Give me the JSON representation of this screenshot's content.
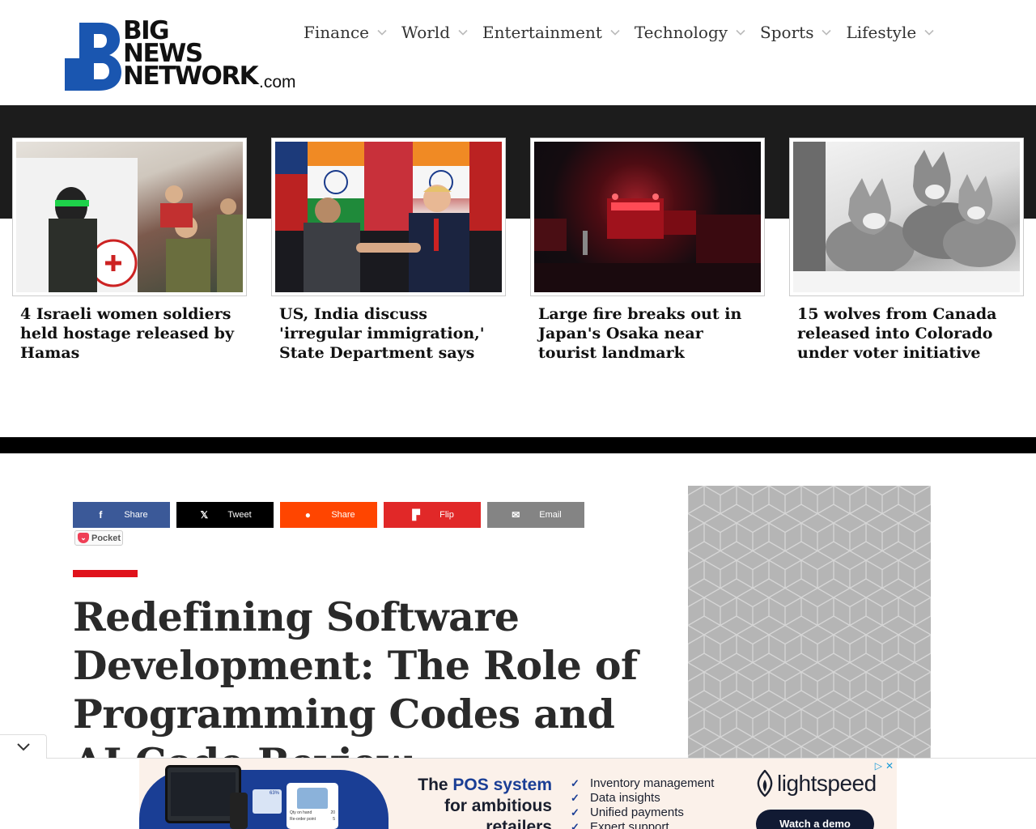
{
  "site": {
    "logo": {
      "line1": "BIG",
      "line2": "NEWS",
      "line3": "NETWORK",
      "suffix": ".com"
    }
  },
  "nav": {
    "items": [
      {
        "label": "Finance"
      },
      {
        "label": "World"
      },
      {
        "label": "Entertainment"
      },
      {
        "label": "Technology"
      },
      {
        "label": "Sports"
      },
      {
        "label": "Lifestyle"
      }
    ]
  },
  "top_stories": [
    {
      "headline": "4 Israeli women soldiers held hostage released by Hamas"
    },
    {
      "headline": "US, India discuss 'irregular immigration,' State Department says"
    },
    {
      "headline": "Large fire breaks out in Japan's Osaka near tourist landmark"
    },
    {
      "headline": "15 wolves from Canada released into Colorado under voter initiative"
    }
  ],
  "share": {
    "buttons": [
      {
        "label": "Share",
        "icon": "f",
        "color": "#3b5998"
      },
      {
        "label": "Tweet",
        "icon": "𝕏",
        "color": "#000000"
      },
      {
        "label": "Share",
        "icon": "●",
        "color": "#ff4500"
      },
      {
        "label": "Flip",
        "icon": "▛",
        "color": "#e12828"
      },
      {
        "label": "Email",
        "icon": "✉",
        "color": "#848484"
      }
    ],
    "pocket_label": "Pocket"
  },
  "article": {
    "title": "Redefining Software Development: The Role of Programming Codes and AI Code Review"
  },
  "banner_ad": {
    "headline_part1": "The ",
    "headline_highlight": "POS system",
    "headline_part2": "for ambitious retailers",
    "bullets": [
      "Inventory management",
      "Data insights",
      "Unified payments",
      "Expert support"
    ],
    "brand": "lightspeed",
    "cta": "Watch a demo",
    "card_on_hand_label": "Qty on hand",
    "card_on_hand_value": "20",
    "card_reorder_label": "Re-order point",
    "card_reorder_value": "5",
    "chart_badge": "63%"
  },
  "colors": {
    "accent_red": "#e0121b",
    "band_dark": "#1c1c1c",
    "lightspeed_navy": "#111a33",
    "banner_blue": "#1a3e95"
  }
}
